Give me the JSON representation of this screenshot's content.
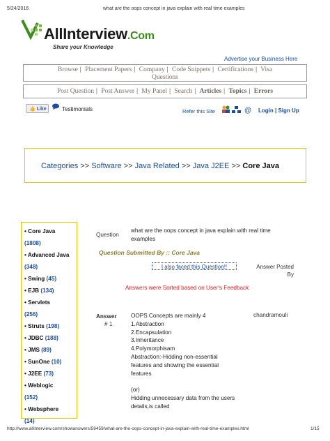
{
  "pdf": {
    "date": "5/24/2016",
    "title": "what are the oops concept in java explain with real time examples",
    "url": "http://www.allinterview.com/showanswers/59459/what-are-the-oops-concept-in-java-explain-with-real-time-examples.html",
    "page": "1/15"
  },
  "brand": {
    "name": "AllInterview",
    "suffix": ".Com",
    "tagline": "Share your Knowledge",
    "accent": "#3d8c1c"
  },
  "advertise": "Advertise your Business Here",
  "nav_main": [
    "Browse",
    "Placement Papers",
    "Company",
    "Code Snippets",
    "Certifications",
    "Visa",
    "Questions"
  ],
  "nav_user": [
    "Post Question",
    "Post Answer",
    "My Panel",
    "Search",
    "Articles",
    "Topics",
    "Errors"
  ],
  "social": {
    "like": "Like",
    "testimonials": "Testimonials",
    "refer": "Refer this Site",
    "login": "Login",
    "signup": "Sign Up"
  },
  "breadcrumb": [
    "Categories",
    "Software",
    "Java Related",
    "Java J2EE",
    "Core Java"
  ],
  "breadcrumb_sep": ">>",
  "sidebar": [
    {
      "name": "Core Java",
      "count": "(1808)"
    },
    {
      "name": "Advanced Java",
      "count": "(348)"
    },
    {
      "name": "Swing",
      "count": "(45)"
    },
    {
      "name": "EJB",
      "count": "(134)"
    },
    {
      "name": "Servlets",
      "count": "(256)"
    },
    {
      "name": "Struts",
      "count": "(198)"
    },
    {
      "name": "JDBC",
      "count": "(188)"
    },
    {
      "name": "JMS",
      "count": "(89)"
    },
    {
      "name": "SunOne",
      "count": "(10)"
    },
    {
      "name": "J2EE",
      "count": "(73)"
    },
    {
      "name": "Weblogic",
      "count": "(152)"
    },
    {
      "name": "Websphere",
      "count": "(14)"
    }
  ],
  "question": {
    "label": "Question",
    "text": "what are the oops concept in java explain with real time examples",
    "submitted": "Question Submitted By :: Core Java",
    "faced": "I also faced this Question!!",
    "answer_posted": "Answer Posted By",
    "sorted": "Answers were Sorted based on User's Feedback"
  },
  "answer": {
    "label": "Answer",
    "num_prefix": "#",
    "num": "1",
    "author": "chandramouli",
    "lines": [
      "OOPS Concepts are mainly 4",
      "1.Abstraction",
      "2.Encapsulation",
      "3.Inheritance",
      "4.Polymorphisam",
      "Abstraction:-Hidding non-essential features and showing the essential features",
      "",
      "(or)",
      "Hidding unnecessary data from the users details,is called"
    ]
  }
}
